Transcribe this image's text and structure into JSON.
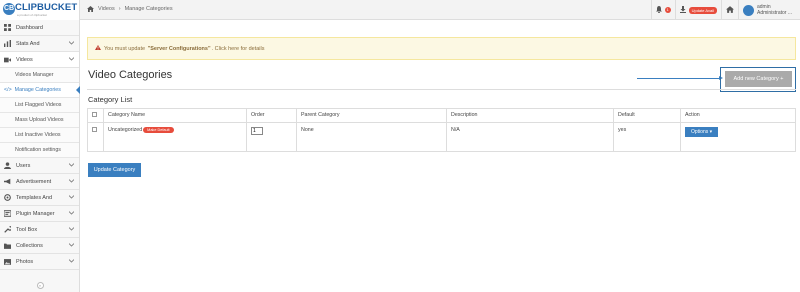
{
  "brand": {
    "logo_text": "CLIPBUCKET",
    "tagline": "a product of clipbucket",
    "logo_mark": "CB"
  },
  "breadcrumb": {
    "items": [
      "Videos",
      "Manage Categories"
    ]
  },
  "topbar": {
    "notification_count": "1",
    "update_badge": "Update Avail",
    "user_name": "admin",
    "user_role": "Administrator ..."
  },
  "sidebar": {
    "items": [
      {
        "label": "Dashboard",
        "icon": "dashboard-icon"
      },
      {
        "label": "Stats And",
        "icon": "stats-icon"
      },
      {
        "label": "Videos",
        "icon": "video-icon"
      },
      {
        "label": "Users",
        "icon": "user-icon"
      },
      {
        "label": "Advertisement",
        "icon": "megaphone-icon"
      },
      {
        "label": "Templates And",
        "icon": "gear-icon"
      },
      {
        "label": "Plugin Manager",
        "icon": "plugin-icon"
      },
      {
        "label": "Tool Box",
        "icon": "wrench-icon"
      },
      {
        "label": "Collections",
        "icon": "folder-icon"
      },
      {
        "label": "Photos",
        "icon": "photo-icon"
      }
    ],
    "video_subitems": [
      "Videos Manager",
      "Manage Categories",
      "List Flagged Videos",
      "Mass Upload Videos",
      "List Inactive Videos",
      "Notification settings"
    ],
    "collapse_glyph": "«"
  },
  "alert": {
    "prefix": "You must update",
    "highlight": "\"Server Configurations\"",
    "suffix": ". Click here for details"
  },
  "page": {
    "title": "Video Categories",
    "add_button": "Add new Category +",
    "section_title": "Category List",
    "update_button": "Update Category"
  },
  "table": {
    "headers": [
      "",
      "Category Name",
      "Order",
      "Parent Category",
      "Description",
      "Default",
      "Action"
    ],
    "rows": [
      {
        "name": "Uncategorized",
        "badge": "Make Default",
        "order": "1",
        "parent": "None",
        "description": "N/A",
        "default": "yes",
        "action": "Options ▾"
      }
    ]
  },
  "colors": {
    "accent": "#3a7fc0",
    "danger": "#e74c3c",
    "alert_bg": "#fcf8e3"
  }
}
